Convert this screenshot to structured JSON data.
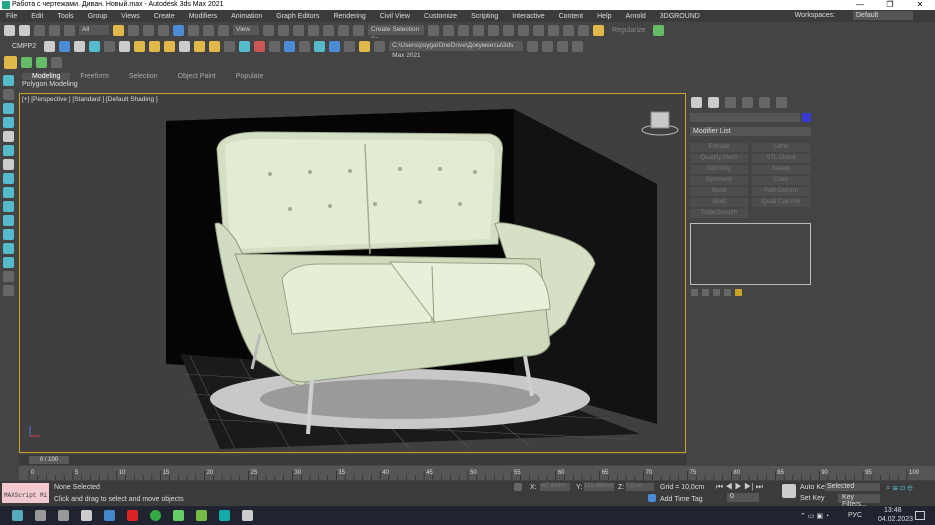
{
  "window": {
    "title": "Работа с чертежами. Диван. Новый.max - Autodesk 3ds Max 2021",
    "min": "—",
    "max": "❐",
    "close": "✕"
  },
  "menubar": {
    "items": [
      "File",
      "Edit",
      "Tools",
      "Group",
      "Views",
      "Create",
      "Modifiers",
      "Animation",
      "Graph Editors",
      "Rendering",
      "Civil View",
      "Customize",
      "Scripting",
      "Interactive",
      "Content",
      "Help",
      "Arnold",
      "3DGROUND"
    ],
    "workspaces_label": "Workspaces:",
    "workspaces_value": "Default"
  },
  "toolbar": {
    "filter": "All",
    "view": "View",
    "selection_set": "Create Selection Se",
    "path": "C:\\Users\\psyga\\OneDrive\\Документы\\3ds Max 2021",
    "regularize": "Regularize",
    "cmpp": "CMPP2"
  },
  "ribbon": {
    "tabs": [
      "Modeling",
      "Freeform",
      "Selection",
      "Object Paint",
      "Populate"
    ],
    "active": "Modeling",
    "sub": "Polygon Modeling"
  },
  "viewport": {
    "label": "[+] [Perspective ] [Standard ] [Default Shading ]"
  },
  "command_panel": {
    "modifier_list": "Modifier List",
    "accent": "#3a3ad0",
    "buttons": [
      "Extrude",
      "Lathe",
      "Quadify Mesh",
      "STL Check",
      "Edit Poly",
      "Sweep",
      "Symmetry",
      "Cloth",
      "Bend",
      "Path Deform",
      "Shell",
      "Quad Cap Pro",
      "TurboSmooth"
    ]
  },
  "timeline": {
    "frame": "0 / 100",
    "ticks": [
      "0",
      "5",
      "10",
      "15",
      "20",
      "25",
      "30",
      "35",
      "40",
      "45",
      "50",
      "55",
      "60",
      "65",
      "70",
      "75",
      "80",
      "85",
      "90",
      "95",
      "100"
    ]
  },
  "status": {
    "maxscript": "MAXScript Mi",
    "selected": "None Selected",
    "hint": "Click and drag to select and move objects",
    "x_label": "X:",
    "x": "-47,843m",
    "y_label": "Y:",
    "y": "132,886cm",
    "z_label": "Z:",
    "z": "0,0cm",
    "grid": "Grid = 10,0cm",
    "add_time_tag": "Add Time Tag",
    "auto_key": "Auto Key",
    "selected_dd": "Selected",
    "set_key": "Set Key",
    "key_filters": "Key Filters...",
    "frame_field": "0"
  },
  "taskbar": {
    "lang": "РУС",
    "time": "13:48",
    "date": "04.02.2023"
  }
}
